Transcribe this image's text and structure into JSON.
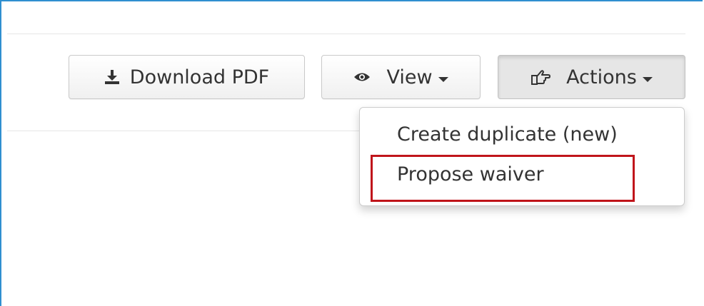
{
  "toolbar": {
    "download_label": "Download PDF",
    "download_icon": "download-icon",
    "view_label": "View",
    "view_icon": "eye-icon",
    "actions_label": "Actions",
    "actions_icon": "hand-pointing-right-icon"
  },
  "actions_menu": {
    "items": [
      {
        "label": "Create duplicate (new)",
        "highlighted": false
      },
      {
        "label": "Propose waiver",
        "highlighted": true
      }
    ]
  },
  "colors": {
    "frame_border": "#2f8fd0",
    "highlight_border": "#c0151b",
    "text": "#333333"
  }
}
